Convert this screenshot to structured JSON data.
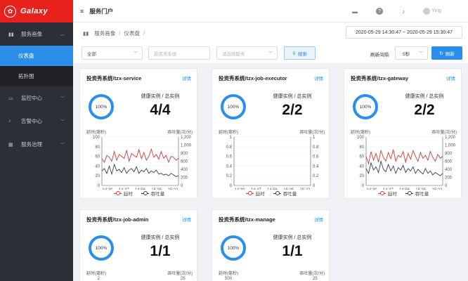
{
  "app": {
    "name": "Galaxy",
    "portal_title": "服务门户",
    "user": "Ying"
  },
  "sidebar": {
    "items": [
      {
        "label": "服务画像",
        "expanded": true
      },
      {
        "label": "监控中心"
      },
      {
        "label": "告警中心"
      },
      {
        "label": "服务治理"
      }
    ],
    "sub_items": [
      {
        "label": "仪表盘",
        "active": true
      },
      {
        "label": "拓扑图"
      }
    ]
  },
  "breadcrumb": {
    "level1": "服务画像",
    "level2": "仪表盘",
    "sep": "/"
  },
  "daterange": "2020-05-29 14:30:47 ~ 2020-05-29 15:30:47",
  "filters": {
    "scope": "全部",
    "system_placeholder": "投资秀系统",
    "service_placeholder": "请选择服务",
    "search_label": "搜索",
    "refresh_interval_label": "刷新间隔:",
    "refresh_interval_value": "5秒",
    "refresh_label": "刷新"
  },
  "colors": {
    "accent": "#2b8ee8",
    "brand": "#e8211c",
    "latency": "#d13b3b",
    "throughput": "#2f3f56"
  },
  "card_common": {
    "detail_link": "详情",
    "ring_text": "100%",
    "health_label": "健康实例 / 总实例",
    "left_axis_label": "延时(毫秒)",
    "right_axis_label": "吞吐量(次/分)",
    "legend_latency": "延时",
    "legend_throughput": "吞吐量"
  },
  "cards": [
    {
      "title": "投资秀系统/tzx-service",
      "health": "4/4",
      "chart_data": {
        "type": "line",
        "x": [
          "14:30",
          "14:47",
          "14:56",
          "15:05",
          "15:22"
        ],
        "left_ticks": [
          "100",
          "80",
          "60",
          "40",
          "20",
          "0"
        ],
        "right_ticks": [
          "1,200",
          "1,000",
          "800",
          "600",
          "400",
          "200",
          "0"
        ],
        "ylim_left": [
          0,
          100
        ],
        "ylim_right": [
          0,
          1200
        ],
        "series": [
          {
            "name": "延时",
            "axis": "left",
            "values": [
              55,
              48,
              62,
              58,
              50,
              70,
              52,
              64,
              60,
              56,
              72,
              50,
              66,
              62,
              58,
              74,
              55,
              68,
              52,
              60,
              75,
              58,
              64,
              54,
              70,
              56,
              62,
              48,
              60,
              58,
              52,
              56
            ]
          },
          {
            "name": "吞吐量",
            "axis": "right",
            "values": [
              360,
              420,
              300,
              480,
              280,
              520,
              360,
              400,
              320,
              440,
              300,
              380,
              420,
              340,
              460,
              300,
              380,
              340,
              420,
              300,
              360,
              320,
              380,
              280,
              300,
              260,
              280,
              240,
              300,
              260,
              220,
              240
            ]
          }
        ]
      }
    },
    {
      "title": "投资秀系统/tzx-job-executor",
      "health": "2/2",
      "chart_data": {
        "type": "line",
        "x": [
          "14:30",
          "14:47",
          "14:56",
          "15:05",
          "15:22"
        ],
        "left_ticks": [
          "1",
          "0.8",
          "0.6",
          "0.4",
          "0.2",
          "0"
        ],
        "right_ticks": [
          "1",
          "0.8",
          "0.6",
          "0.4",
          "0.2",
          "0"
        ],
        "ylim_left": [
          0,
          1
        ],
        "ylim_right": [
          0,
          1
        ],
        "series": [
          {
            "name": "延时",
            "axis": "left",
            "values": []
          },
          {
            "name": "吞吐量",
            "axis": "right",
            "values": []
          }
        ]
      }
    },
    {
      "title": "投资秀系统/tzx-gateway",
      "health": "2/2",
      "chart_data": {
        "type": "line",
        "x": [
          "14:30",
          "14:47",
          "14:56",
          "15:05",
          "15:22"
        ],
        "left_ticks": [
          "100",
          "80",
          "60",
          "40",
          "20",
          "0"
        ],
        "right_ticks": [
          "1,200",
          "1,000",
          "800",
          "600",
          "400",
          "200",
          "0"
        ],
        "ylim_left": [
          0,
          100
        ],
        "ylim_right": [
          0,
          1200
        ],
        "series": [
          {
            "name": "延时",
            "axis": "left",
            "values": [
              60,
              45,
              70,
              52,
              66,
              48,
              72,
              58,
              50,
              68,
              55,
              74,
              50,
              62,
              58,
              70,
              48,
              66,
              54,
              72,
              60,
              50,
              68,
              56,
              62,
              52,
              70,
              58,
              50,
              64,
              56,
              60
            ]
          },
          {
            "name": "吞吐量",
            "axis": "right",
            "values": [
              420,
              300,
              560,
              380,
              460,
              320,
              600,
              400,
              340,
              520,
              360,
              480,
              300,
              440,
              380,
              500,
              320,
              420,
              360,
              460,
              300,
              400,
              340,
              280,
              420,
              300,
              360,
              260,
              320,
              280,
              240,
              300
            ]
          }
        ]
      }
    },
    {
      "title": "投资秀系统/tzx-job-admin",
      "health": "1/1",
      "chart_data": {
        "type": "line",
        "x": [],
        "left_ticks": [
          "2"
        ],
        "right_ticks": [
          "25"
        ],
        "series": []
      }
    },
    {
      "title": "投资秀系统/tzx-manage",
      "health": "1/1",
      "chart_data": {
        "type": "line",
        "x": [],
        "left_ticks": [
          "500"
        ],
        "right_ticks": [
          "25"
        ],
        "series": []
      }
    }
  ]
}
